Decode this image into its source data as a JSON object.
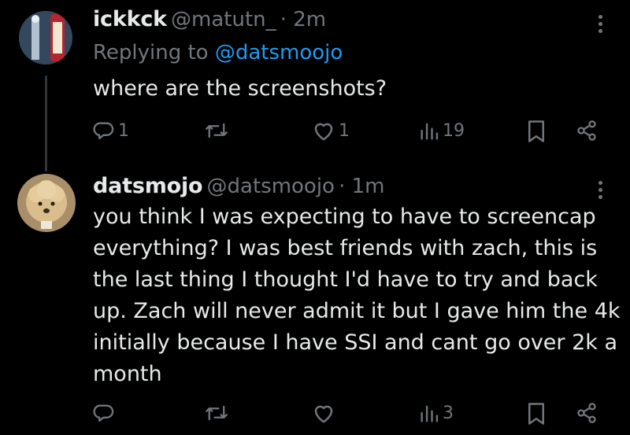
{
  "tweets": [
    {
      "name": "ickkck",
      "handle": "@matutn_",
      "time": "· 2m",
      "replying_prefix": "Replying to",
      "replying_to": "@datsmoojo",
      "text": "where are the screenshots?",
      "actions": {
        "replies": "1",
        "retweets": "",
        "likes": "1",
        "views": "19"
      }
    },
    {
      "name": "datsmojo",
      "handle": "@datsmoojo",
      "time": "· 1m",
      "lines": [
        "you think I was expecting to have to screencap",
        "everything? I was best friends with zach, this is",
        "the last thing I thought I'd have to try and back",
        "up. Zach will never admit it but I gave him the 4k",
        "initially because I have SSI and cant go over 2k a",
        "month"
      ],
      "actions": {
        "replies": "",
        "retweets": "",
        "likes": "",
        "views": "3"
      }
    }
  ],
  "colors": {
    "background": "#000000",
    "text": "#e7e9ea",
    "secondary": "#71767b",
    "accent": "#1d9bf0"
  },
  "icons": [
    "reply-icon",
    "retweet-icon",
    "like-icon",
    "views-icon",
    "bookmark-icon",
    "share-icon",
    "more-icon"
  ]
}
